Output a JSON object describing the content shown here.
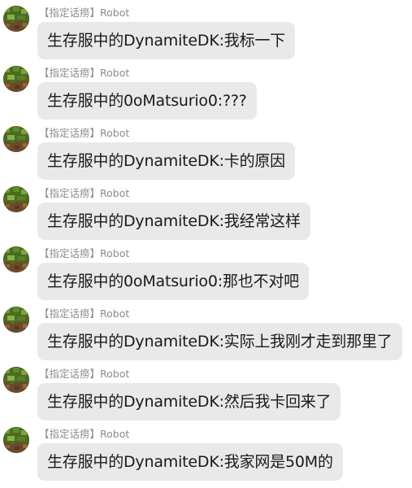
{
  "messages": [
    {
      "sender": "【指定话痨】Robot",
      "text": "生存服中的DynamiteDK:我标一下"
    },
    {
      "sender": "【指定话痨】Robot",
      "text": "生存服中的0oMatsurio0:???"
    },
    {
      "sender": "【指定话痨】Robot",
      "text": "生存服中的DynamiteDK:卡的原因"
    },
    {
      "sender": "【指定话痨】Robot",
      "text": "生存服中的DynamiteDK:我经常这样"
    },
    {
      "sender": "【指定话痨】Robot",
      "text": "生存服中的0oMatsurio0:那也不对吧"
    },
    {
      "sender": "【指定话痨】Robot",
      "text": "生存服中的DynamiteDK:实际上我刚才走到那里了"
    },
    {
      "sender": "【指定话痨】Robot",
      "text": "生存服中的DynamiteDK:然后我卡回来了"
    },
    {
      "sender": "【指定话痨】Robot",
      "text": "生存服中的DynamiteDK:我家网是50M的"
    }
  ],
  "avatar_icon": "minecraft-grass-block-avatar-icon"
}
